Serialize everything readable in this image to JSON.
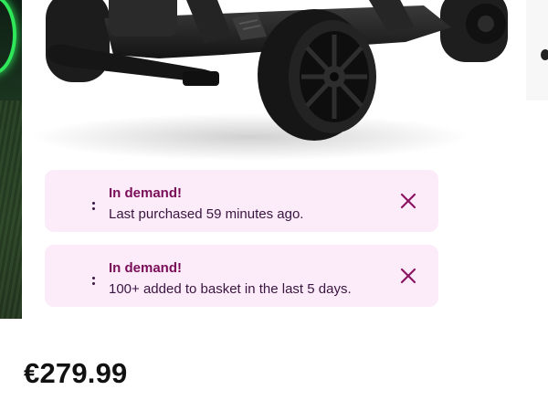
{
  "product": {
    "image_icon": "go-kart-image",
    "price": "€279.99"
  },
  "banners": [
    {
      "title": "In demand!",
      "message": "Last purchased 59 minutes ago.",
      "dismiss_icon": "close-icon"
    },
    {
      "title": "In demand!",
      "message": "100+ added to basket in the last 5 days.",
      "dismiss_icon": "close-icon"
    }
  ],
  "colors": {
    "banner_background": "#fcecfa",
    "banner_title": "#7a0d57",
    "banner_text": "#3a1540",
    "close_icon": "#8a1462",
    "price": "#111111"
  }
}
